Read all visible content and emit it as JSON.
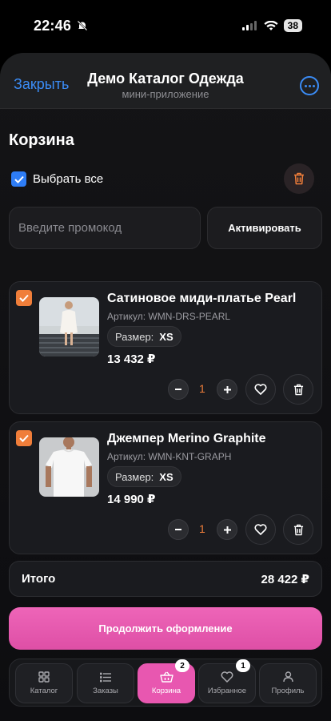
{
  "status_bar": {
    "time": "22:46",
    "battery": "38"
  },
  "header": {
    "close_label": "Закрыть",
    "title": "Демо Каталог Одежда",
    "subtitle": "мини-приложение"
  },
  "cart": {
    "title": "Корзина",
    "select_all_label": "Выбрать все",
    "select_all_checked": true,
    "promo": {
      "placeholder": "Введите промокод",
      "value": "",
      "button_label": "Активировать"
    },
    "items": [
      {
        "name": "Сатиновое миди-платье Pearl",
        "sku": "Артикул: WMN-DRS-PEARL",
        "size_label": "Размер:",
        "size": "XS",
        "price": "13 432 ₽",
        "qty": "1",
        "checked": true,
        "image": "white-dress-photo"
      },
      {
        "name": "Джемпер Merino Graphite",
        "sku": "Артикул: WMN-KNT-GRAPH",
        "size_label": "Размер:",
        "size": "XS",
        "price": "14 990 ₽",
        "qty": "1",
        "checked": true,
        "image": "white-tshirt-photo"
      }
    ],
    "total_label": "Итого",
    "total_value": "28 422 ₽",
    "checkout_label": "Продолжить оформление"
  },
  "tabbar": {
    "tabs": [
      {
        "label": "Каталог",
        "icon": "grid-icon",
        "active": false,
        "badge": ""
      },
      {
        "label": "Заказы",
        "icon": "list-icon",
        "active": false,
        "badge": ""
      },
      {
        "label": "Корзина",
        "icon": "basket-icon",
        "active": true,
        "badge": "2"
      },
      {
        "label": "Избранное",
        "icon": "heart-icon",
        "active": false,
        "badge": "1"
      },
      {
        "label": "Профиль",
        "icon": "user-icon",
        "active": false,
        "badge": ""
      }
    ]
  },
  "colors": {
    "accent_blue": "#3b8cf6",
    "accent_orange": "#f07e3a",
    "accent_pink": "#e857b0",
    "danger": "#f07e3a"
  }
}
